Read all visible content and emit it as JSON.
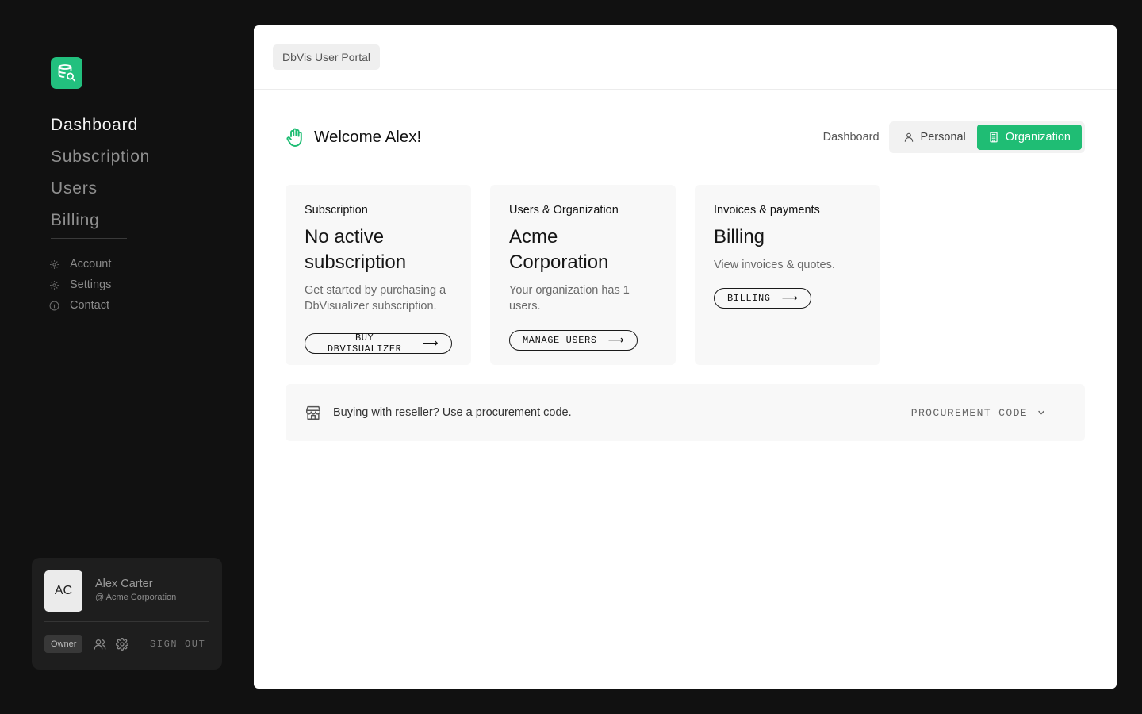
{
  "sidebar": {
    "logo_icon": "database-search-icon",
    "nav_main": [
      {
        "label": "Dashboard",
        "active": true
      },
      {
        "label": "Subscription",
        "active": false
      },
      {
        "label": "Users",
        "active": false
      },
      {
        "label": "Billing",
        "active": false
      }
    ],
    "nav_sub": [
      {
        "label": "Account",
        "icon": "gear-icon"
      },
      {
        "label": "Settings",
        "icon": "gear-icon"
      },
      {
        "label": "Contact",
        "icon": "info-icon"
      }
    ],
    "user": {
      "initials": "AC",
      "name": "Alex Carter",
      "org": "@ Acme Corporation",
      "role": "Owner",
      "signout_label": "SIGN OUT"
    }
  },
  "header": {
    "portal_label": "DbVis User Portal"
  },
  "main": {
    "welcome": "Welcome Alex!",
    "tabs": {
      "dashboard_label": "Dashboard",
      "personal_label": "Personal",
      "organization_label": "Organization",
      "active": "Organization"
    },
    "cards": [
      {
        "eyebrow": "Subscription",
        "title": "No active subscription",
        "desc": "Get started by purchasing a DbVisualizer subscription.",
        "button": "BUY DBVISUALIZER"
      },
      {
        "eyebrow": "Users & Organization",
        "title": "Acme Corporation",
        "desc": "Your organization has 1 users.",
        "button": "MANAGE USERS"
      },
      {
        "eyebrow": "Invoices & payments",
        "title": "Billing",
        "desc": "View invoices & quotes.",
        "button": "BILLING"
      }
    ],
    "procurement": {
      "text": "Buying with reseller? Use a procurement code.",
      "button": "PROCUREMENT CODE"
    }
  },
  "colors": {
    "accent": "#1fbd74",
    "logo": "#22c07e",
    "background": "#111111"
  }
}
